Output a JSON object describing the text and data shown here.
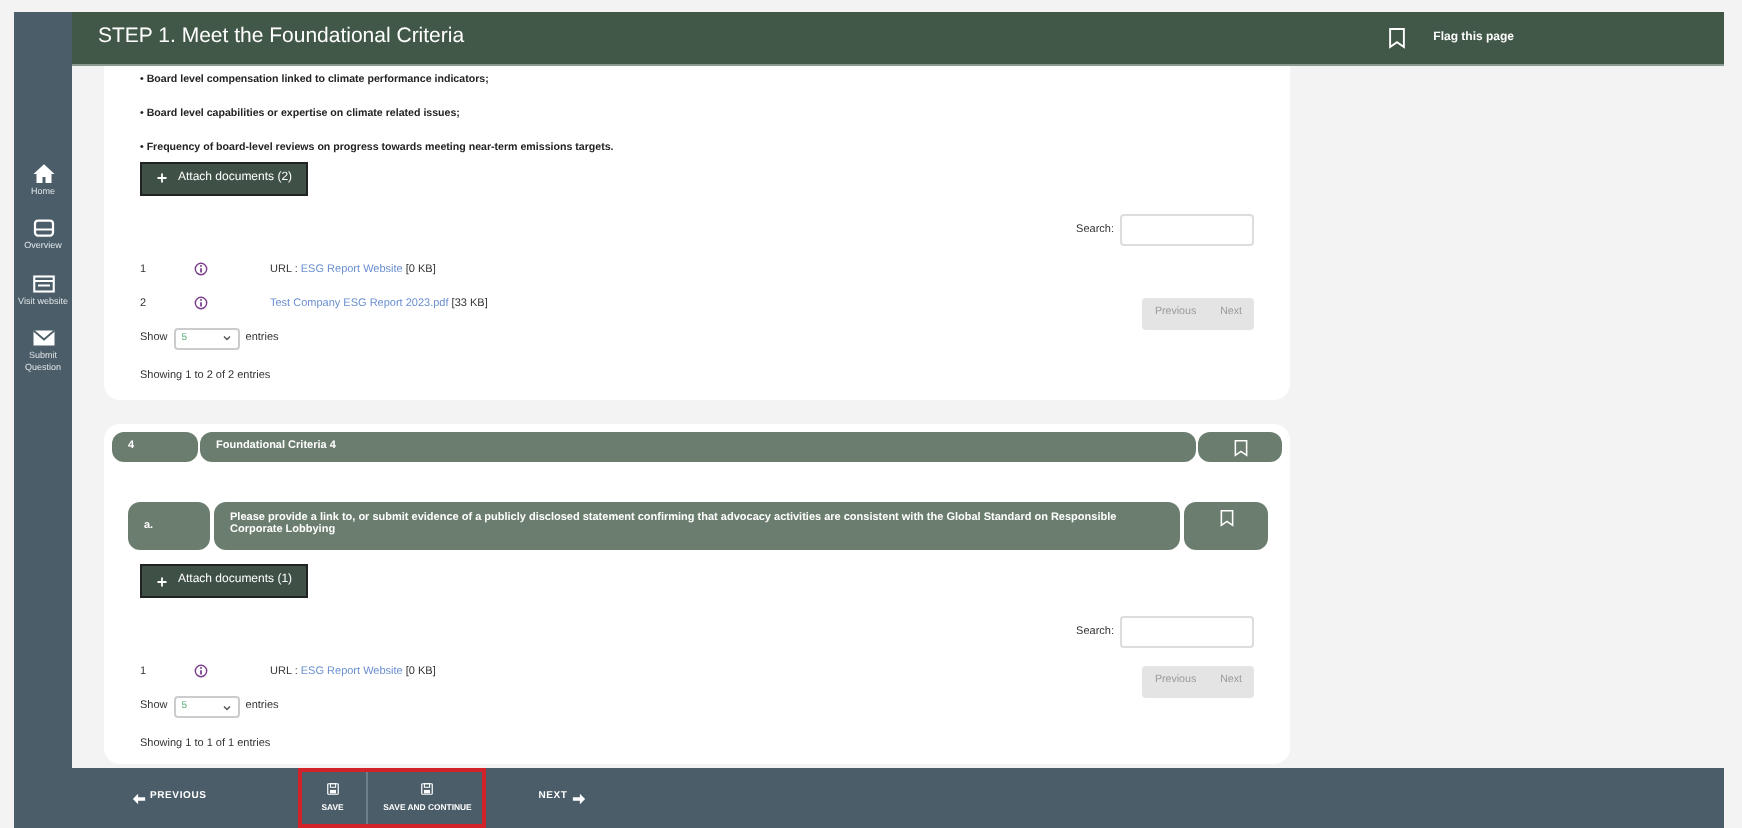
{
  "header": {
    "title": "STEP 1. Meet the Foundational Criteria",
    "flag_label": "Flag this page"
  },
  "sidebar": {
    "items": [
      {
        "label": "Home",
        "kind": "home"
      },
      {
        "label": "Overview",
        "kind": "overview"
      },
      {
        "label": "Visit website",
        "kind": "website"
      },
      {
        "label": "Submit Question",
        "kind": "mail"
      }
    ]
  },
  "sections": [
    {
      "bullets": [
        "• Board level compensation linked to climate performance indicators;",
        "• Board level capabilities or expertise on climate related issues;",
        "• Frequency of board-level reviews on progress towards meeting near-term emissions targets."
      ],
      "attach_label": "Attach documents (2)",
      "search_label": "Search:",
      "documents": [
        {
          "index": "1",
          "prefix": "URL : ",
          "link": "ESG Report Website",
          "size": "[0 KB]"
        },
        {
          "index": "2",
          "link": "Test Company ESG Report 2023.pdf",
          "size": "[33 KB]"
        }
      ],
      "show_label": "Show",
      "page_size": "5",
      "entries_label": "entries",
      "info": "Showing 1 to 2 of 2 entries",
      "pagination": [
        {
          "label": "Previous",
          "disabled": true
        },
        {
          "label": "Next",
          "disabled": true
        }
      ]
    },
    {
      "criteria": {
        "number": "4",
        "title": "Foundational Criteria 4"
      },
      "question": {
        "label": "a.",
        "text": "Please provide a link to, or submit evidence of a publicly disclosed statement confirming that advocacy activities are consistent with the Global Standard on Responsible Corporate Lobbying"
      },
      "attach_label": "Attach documents (1)",
      "search_label": "Search:",
      "documents": [
        {
          "index": "1",
          "prefix": "URL : ",
          "link": "ESG Report Website",
          "size": "[0 KB]"
        }
      ],
      "show_label": "Show",
      "page_size": "5",
      "entries_label": "entries",
      "info": "Showing 1 to 1 of 1 entries",
      "pagination": [
        {
          "label": "Previous",
          "disabled": true
        },
        {
          "label": "Next",
          "disabled": true
        }
      ]
    }
  ],
  "footer": {
    "previous": "PREVIOUS",
    "save_group": {
      "highlighted": true,
      "buttons": [
        {
          "label": "SAVE"
        },
        {
          "label": "SAVE AND CONTINUE"
        }
      ]
    },
    "next": "NEXT"
  }
}
